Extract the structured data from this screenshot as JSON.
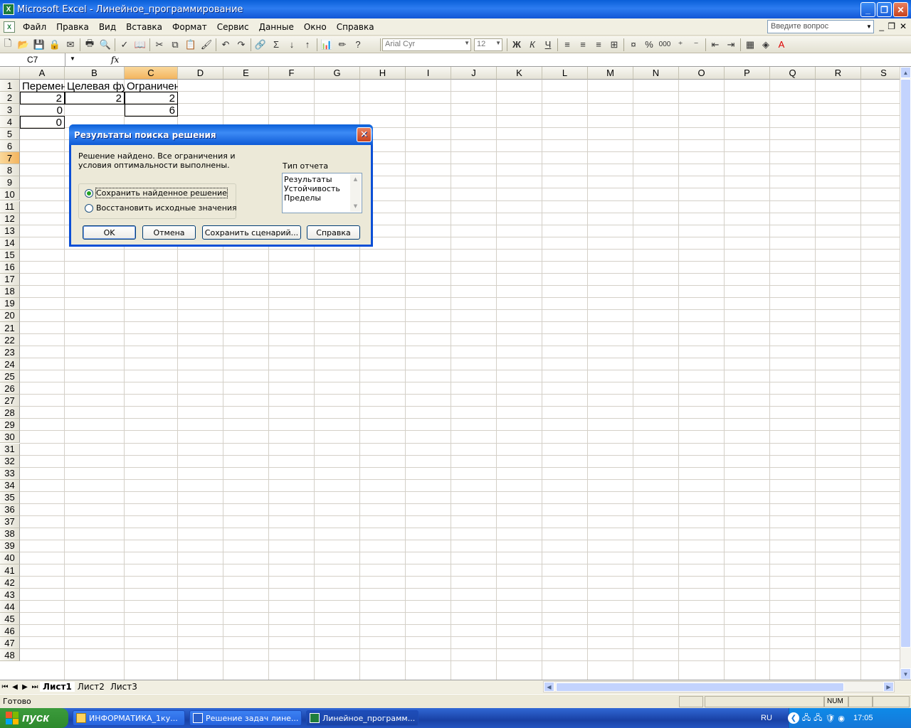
{
  "window": {
    "title": "Microsoft Excel - Линейное_программирование",
    "app_icon_label": "X"
  },
  "menu": {
    "items": [
      "Файл",
      "Правка",
      "Вид",
      "Вставка",
      "Формат",
      "Сервис",
      "Данные",
      "Окно",
      "Справка"
    ],
    "ask_placeholder": "Введите вопрос"
  },
  "toolbar": {
    "font_name": "Arial Cyr",
    "font_size": "12",
    "bold": "Ж",
    "italic": "К",
    "underline": "Ч",
    "percent": "%",
    "thousands": "000"
  },
  "formula_bar": {
    "name_box": "C7",
    "fx": "fx",
    "formula": ""
  },
  "grid": {
    "columns": [
      "A",
      "B",
      "C",
      "D",
      "E",
      "F",
      "G",
      "H",
      "I",
      "J",
      "K",
      "L",
      "M",
      "N",
      "O",
      "P",
      "Q",
      "R",
      "S"
    ],
    "selected_column": "C",
    "selected_row": 7,
    "row_count": 48,
    "cells": {
      "A1": "Переменные",
      "B1": "Целевая функция",
      "C1": "Ограничения",
      "A2": "2",
      "B2": "2",
      "C2": "2",
      "A3": "0",
      "C3": "6",
      "A4": "0"
    }
  },
  "sheets": {
    "tabs": [
      "Лист1",
      "Лист2",
      "Лист3"
    ],
    "active": "Лист1"
  },
  "status": {
    "text": "Готово",
    "num": "NUM"
  },
  "dialog": {
    "title": "Результаты поиска решения",
    "message": "Решение найдено. Все ограничения и условия оптимальности выполнены.",
    "keep_solution": "Сохранить найденное решение",
    "restore_values": "Восстановить исходные значения",
    "report_type_label": "Тип отчета",
    "reports": [
      "Результаты",
      "Устойчивость",
      "Пределы"
    ],
    "ok": "OK",
    "cancel": "Отмена",
    "save_scenario": "Сохранить сценарий...",
    "help": "Справка"
  },
  "taskbar": {
    "start": "пуск",
    "tasks": [
      "ИНФОРМАТИКА_1ку...",
      "Решение задач лине...",
      "Линейное_программ..."
    ],
    "active_task": 2,
    "lang": "RU",
    "clock": "17:05"
  }
}
